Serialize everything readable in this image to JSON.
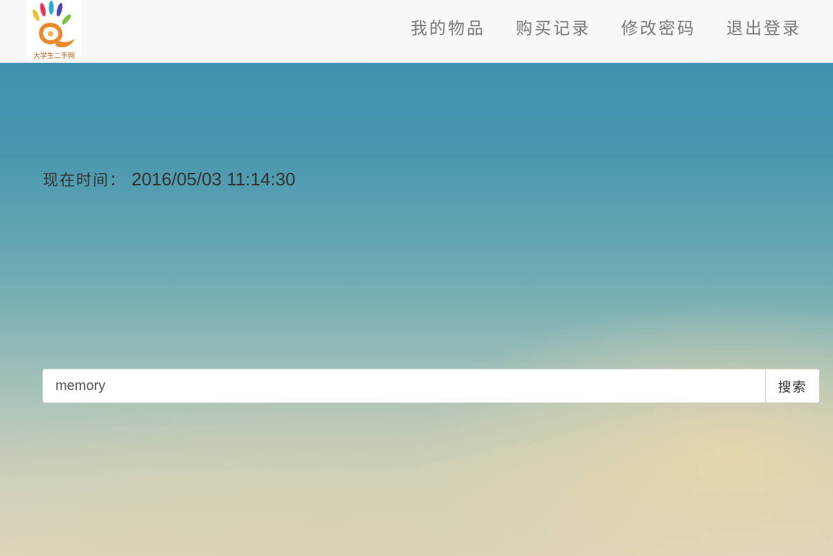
{
  "navbar": {
    "logo": {
      "name": "site-logo",
      "caption": "大学生二手网"
    },
    "links": [
      {
        "label": "我的物品",
        "icon": null
      },
      {
        "label": "购买记录",
        "icon": null
      },
      {
        "label": "修改密码",
        "icon": null
      },
      {
        "label": "退出登录",
        "icon": null
      }
    ]
  },
  "main": {
    "time_label": "现在时间：",
    "time_value": "2016/05/03 11:14:30"
  },
  "search": {
    "value": "memory",
    "placeholder": "",
    "button_label": "搜索"
  },
  "colors": {
    "navbar_bg": "#f8f8f8",
    "nav_text": "#777777",
    "sky_top": "#3a8daf",
    "sky_bottom": "#ddd6bc",
    "text_dark": "#333333"
  }
}
